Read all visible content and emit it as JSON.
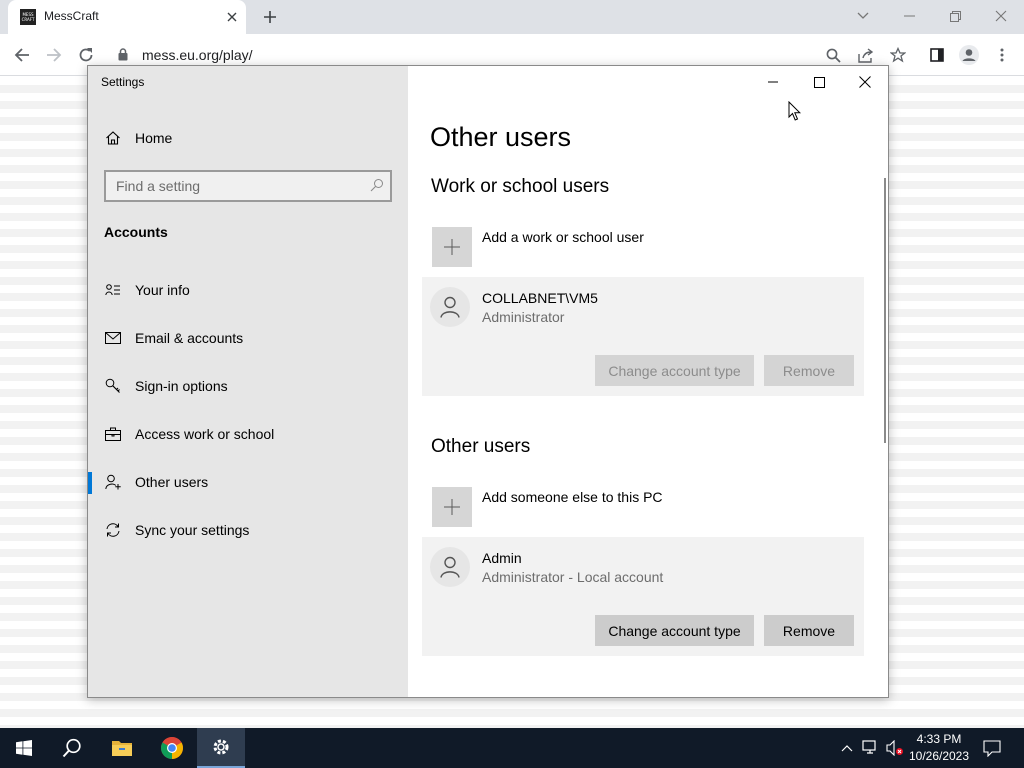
{
  "browser": {
    "tab": {
      "title": "MessCraft",
      "favicon_text": "MESS CRAFT"
    },
    "url": "mess.eu.org/play/",
    "icons": [
      "back-icon",
      "forward-icon",
      "reload-icon",
      "lock-icon",
      "search-icon",
      "share-icon",
      "star-icon",
      "sidepanel-icon",
      "profile-icon",
      "menu-icon"
    ]
  },
  "settings": {
    "window_title": "Settings",
    "home_label": "Home",
    "search_placeholder": "Find a setting",
    "section": "Accounts",
    "nav": [
      {
        "label": "Your info",
        "icon": "person-card-icon"
      },
      {
        "label": "Email & accounts",
        "icon": "mail-icon"
      },
      {
        "label": "Sign-in options",
        "icon": "key-icon"
      },
      {
        "label": "Access work or school",
        "icon": "briefcase-icon"
      },
      {
        "label": "Other users",
        "icon": "add-person-icon",
        "selected": true
      },
      {
        "label": "Sync your settings",
        "icon": "sync-icon"
      }
    ],
    "accent": "#0078d7"
  },
  "content": {
    "page_title": "Other users",
    "work_heading": "Work or school users",
    "work_add": "Add a work or school user",
    "work_user": {
      "name": "COLLABNET\\VM5",
      "role": "Administrator"
    },
    "work_buttons": {
      "change": "Change account type",
      "remove": "Remove"
    },
    "other_heading": "Other users",
    "other_add": "Add someone else to this PC",
    "other_user": {
      "name": "Admin",
      "role": "Administrator - Local account"
    },
    "other_buttons": {
      "change": "Change account type",
      "remove": "Remove"
    }
  },
  "taskbar": {
    "time": "4:33 PM",
    "date": "10/26/2023"
  }
}
